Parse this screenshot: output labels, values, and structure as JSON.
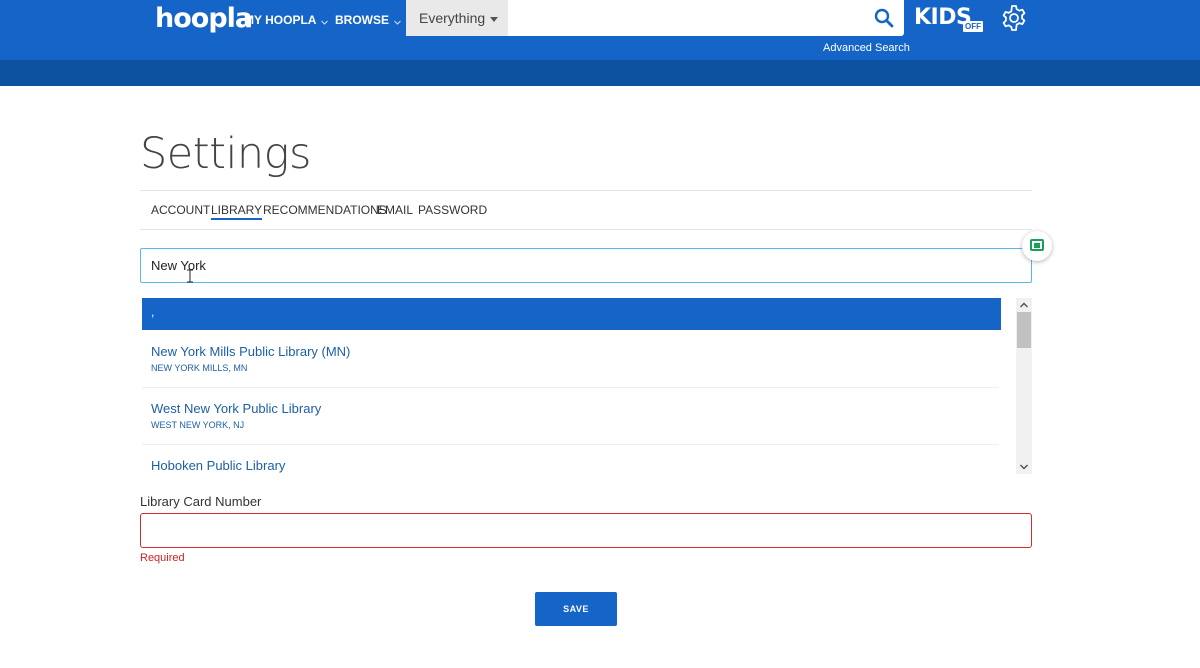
{
  "header": {
    "logo_text": "hoopla",
    "nav": {
      "my_hoopla": "MY HOOPLA",
      "browse": "BROWSE"
    },
    "search": {
      "scope": "Everything",
      "value": "",
      "placeholder": ""
    },
    "advanced_search": "Advanced Search",
    "kids": {
      "label": "KIDS",
      "badge": "OFF"
    }
  },
  "main": {
    "title": "Settings",
    "tabs": [
      {
        "label": "ACCOUNT",
        "active": false
      },
      {
        "label": "LIBRARY",
        "active": true
      },
      {
        "label": "RECOMMENDATIONS",
        "active": false
      },
      {
        "label": "EMAIL",
        "active": false
      },
      {
        "label": "PASSWORD",
        "active": false
      }
    ],
    "library_search": {
      "value": "New York"
    },
    "dropdown": {
      "highlighted": ",",
      "items": [
        {
          "name": "New York Mills Public Library (MN)",
          "location": "NEW YORK MILLS, MN"
        },
        {
          "name": "West New York Public Library",
          "location": "WEST NEW YORK, NJ"
        },
        {
          "name": "Hoboken Public Library",
          "location": ""
        }
      ]
    },
    "card_number": {
      "label": "Library Card Number",
      "value": "",
      "error": "Required"
    },
    "save_label": "SAVE"
  },
  "colors": {
    "brand_blue": "#1565c8",
    "header_dark": "#0d52a0",
    "error_red": "#d42b2b",
    "link_blue": "#1d5fa6",
    "focus_border": "#5bb6ea"
  }
}
